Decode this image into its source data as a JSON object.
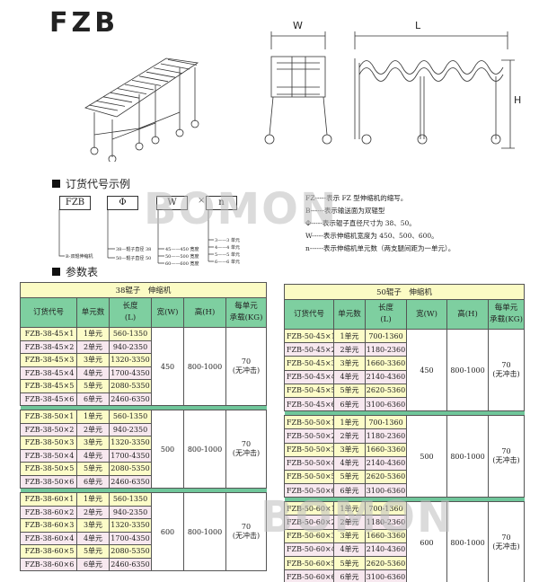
{
  "title": "FZB",
  "watermark": "BOMON",
  "drawing": {
    "dim_w": "W",
    "dim_l": "L",
    "dim_h": "H"
  },
  "order_code": {
    "heading": "订货代号示例",
    "boxes": [
      "FZB",
      "Φ",
      "W",
      "n"
    ],
    "times": "×",
    "fzb_note": "B-双辊伸缩机",
    "phi_notes": [
      "38—辊子直径 38",
      "50—辊子直径 50"
    ],
    "w_notes": [
      "45——450 宽度",
      "50——500 宽度",
      "60——600 宽度"
    ],
    "n_notes": [
      "3——3 单元",
      "4——4 单元",
      "5——5 单元",
      "6——6 单元"
    ],
    "legend": [
      "FZ-----表示 FZ 型伸缩机的缩写。",
      "B------表示输送面为双辊型",
      "Φ-----表示辊子直径尺寸为 38、50。",
      "W-----表示伸缩机宽度为 450、500、600。",
      "n------表示伸缩机单元数（两支腿间距为一单元）。"
    ]
  },
  "params_heading": "参数表",
  "tables": [
    {
      "title": "38辊子　伸缩机",
      "headers": [
        "订货代号",
        "单元数",
        "长度\n(L)",
        "宽(W)",
        "高(H)",
        "每单元\n承载(KG)"
      ],
      "groups": [
        {
          "width": "450",
          "height": "800-1000",
          "load": "70",
          "load_note": "(无冲击)",
          "rows": [
            [
              "FZB-38-45×1",
              "1单元",
              "560-1350"
            ],
            [
              "FZB-38-45×2",
              "2单元",
              "940-2350"
            ],
            [
              "FZB-38-45×3",
              "3单元",
              "1320-3350"
            ],
            [
              "FZB-38-45×4",
              "4单元",
              "1700-4350"
            ],
            [
              "FZB-38-45×5",
              "5单元",
              "2080-5350"
            ],
            [
              "FZB-38-45×6",
              "6单元",
              "2460-6350"
            ]
          ]
        },
        {
          "width": "500",
          "height": "800-1000",
          "load": "70",
          "load_note": "(无冲击)",
          "rows": [
            [
              "FZB-38-50×1",
              "1单元",
              "560-1350"
            ],
            [
              "FZB-38-50×2",
              "2单元",
              "940-2350"
            ],
            [
              "FZB-38-50×3",
              "3单元",
              "1320-3350"
            ],
            [
              "FZB-38-50×4",
              "4单元",
              "1700-4350"
            ],
            [
              "FZB-38-50×5",
              "5单元",
              "2080-5350"
            ],
            [
              "FZB-38-50×6",
              "6单元",
              "2460-6350"
            ]
          ]
        },
        {
          "width": "600",
          "height": "800-1000",
          "load": "70",
          "load_note": "(无冲击)",
          "rows": [
            [
              "FZB-38-60×1",
              "1单元",
              "560-1350"
            ],
            [
              "FZB-38-60×2",
              "2单元",
              "940-2350"
            ],
            [
              "FZB-38-60×3",
              "3单元",
              "1320-3350"
            ],
            [
              "FZB-38-60×4",
              "4单元",
              "1700-4350"
            ],
            [
              "FZB-38-60×5",
              "5单元",
              "2080-5350"
            ],
            [
              "FZB-38-60×6",
              "6单元",
              "2460-6350"
            ]
          ]
        }
      ]
    },
    {
      "title": "50辊子　伸缩机",
      "headers": [
        "订货代号",
        "单元数",
        "长度\n(L)",
        "宽(W)",
        "高(H)",
        "每单元\n承载(KG)"
      ],
      "groups": [
        {
          "width": "450",
          "height": "800-1000",
          "load": "70",
          "load_note": "(无冲击)",
          "rows": [
            [
              "FZB-50-45×1",
              "1单元",
              "700-1360"
            ],
            [
              "FZB-50-45×2",
              "2单元",
              "1180-2360"
            ],
            [
              "FZB-50-45×3",
              "3单元",
              "1660-3360"
            ],
            [
              "FZB-50-45×4",
              "4单元",
              "2140-4360"
            ],
            [
              "FZB-50-45×5",
              "5单元",
              "2620-5360"
            ],
            [
              "FZB-50-45×6",
              "6单元",
              "3100-6360"
            ]
          ]
        },
        {
          "width": "500",
          "height": "800-1000",
          "load": "70",
          "load_note": "(无冲击)",
          "rows": [
            [
              "FZB-50-50×1",
              "1单元",
              "700-1360"
            ],
            [
              "FZB-50-50×2",
              "2单元",
              "1180-2360"
            ],
            [
              "FZB-50-50×3",
              "3单元",
              "1660-3360"
            ],
            [
              "FZB-50-50×4",
              "4单元",
              "2140-4360"
            ],
            [
              "FZB-50-50×5",
              "5单元",
              "2620-5360"
            ],
            [
              "FZB-50-50×6",
              "6单元",
              "3100-6360"
            ]
          ]
        },
        {
          "width": "600",
          "height": "800-1000",
          "load": "70",
          "load_note": "(无冲击)",
          "rows": [
            [
              "FZB-50-60×1",
              "1单元",
              "700-1360"
            ],
            [
              "FZB-50-60×2",
              "2单元",
              "1180-2360"
            ],
            [
              "FZB-50-60×3",
              "3单元",
              "1660-3360"
            ],
            [
              "FZB-50-60×4",
              "4单元",
              "2140-4360"
            ],
            [
              "FZB-50-60×5",
              "5单元",
              "2620-5360"
            ],
            [
              "FZB-50-60×6",
              "6单元",
              "3100-6360"
            ]
          ]
        }
      ]
    }
  ]
}
